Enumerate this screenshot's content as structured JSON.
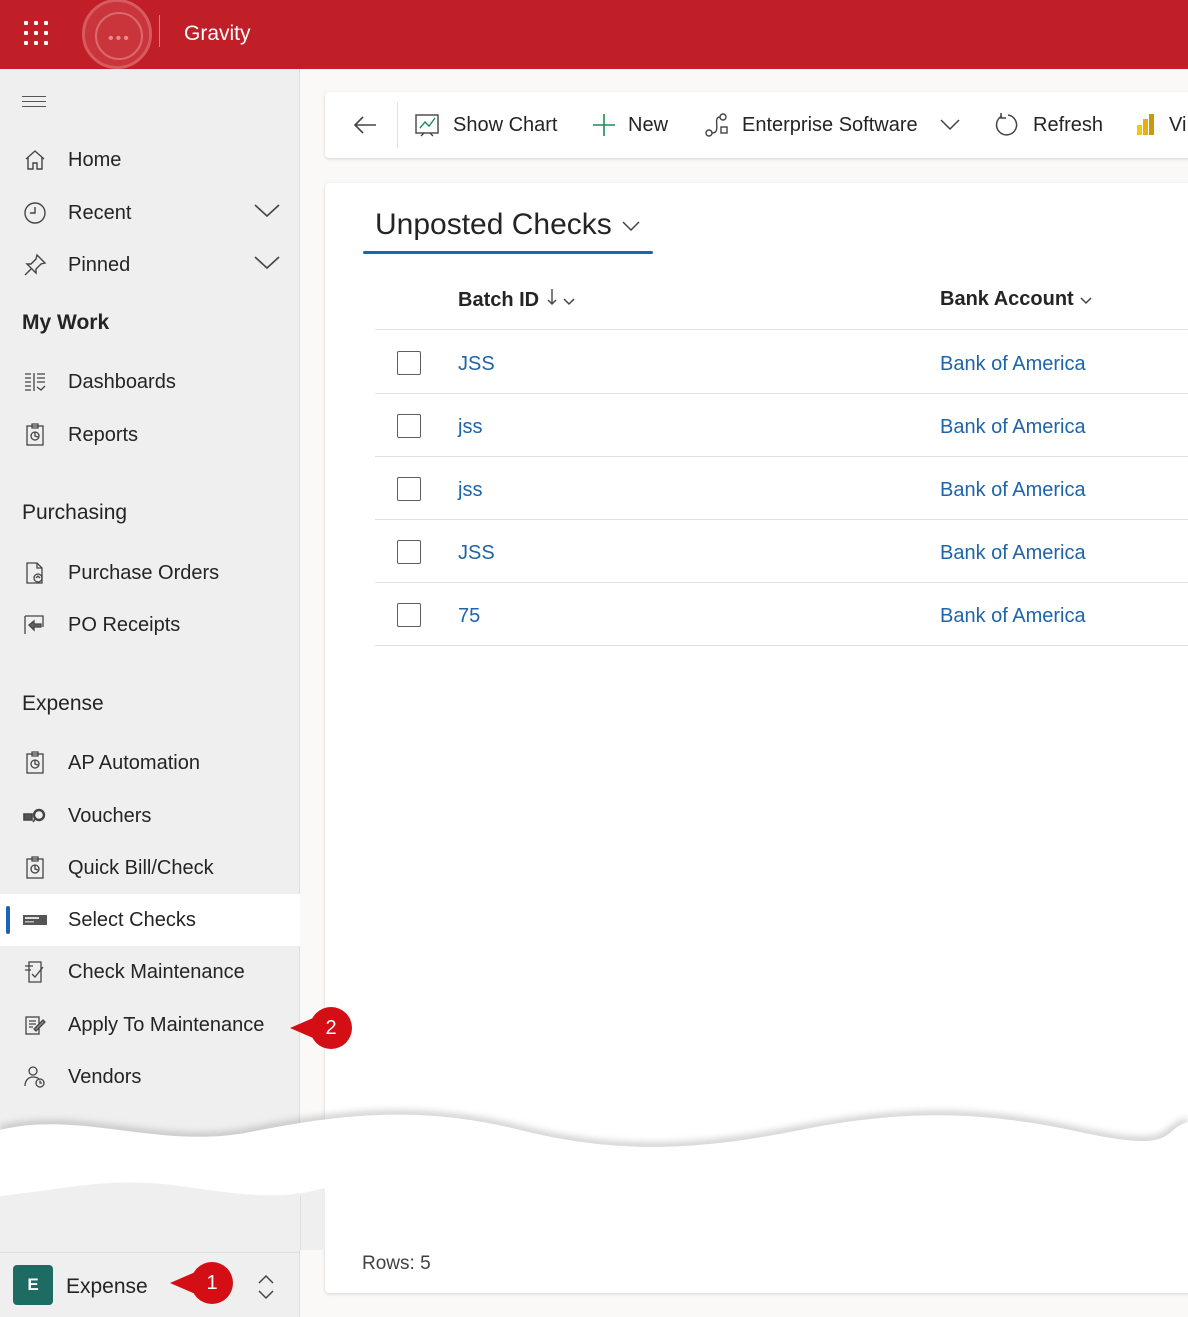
{
  "app": {
    "name": "Gravity"
  },
  "sidebar": {
    "top_items": [
      {
        "label": "Home",
        "icon": "home-icon"
      },
      {
        "label": "Recent",
        "icon": "clock-icon"
      },
      {
        "label": "Pinned",
        "icon": "pin-icon"
      }
    ],
    "groups": [
      {
        "title": "My Work",
        "items": [
          {
            "label": "Dashboards",
            "icon": "dashboard-icon"
          },
          {
            "label": "Reports",
            "icon": "report-icon"
          }
        ]
      },
      {
        "title": "Purchasing",
        "items": [
          {
            "label": "Purchase Orders",
            "icon": "purchase-order-icon"
          },
          {
            "label": "PO Receipts",
            "icon": "receipt-icon"
          }
        ]
      },
      {
        "title": "Expense",
        "items": [
          {
            "label": "AP Automation",
            "icon": "report-icon"
          },
          {
            "label": "Vouchers",
            "icon": "voucher-icon"
          },
          {
            "label": "Quick Bill/Check",
            "icon": "report-icon"
          },
          {
            "label": "Select Checks",
            "icon": "check-card-icon",
            "selected": true
          },
          {
            "label": "Check Maintenance",
            "icon": "check-maintenance-icon"
          },
          {
            "label": "Apply To Maintenance",
            "icon": "apply-maintenance-icon"
          },
          {
            "label": "Vendors",
            "icon": "vendors-icon"
          }
        ]
      }
    ],
    "area": {
      "badge": "E",
      "name": "Expense"
    }
  },
  "callouts": {
    "one": "1",
    "two": "2"
  },
  "commands": {
    "show_chart": "Show Chart",
    "new": "New",
    "enterprise": "Enterprise Software",
    "refresh": "Refresh",
    "truncated": "Vi"
  },
  "view": {
    "title": "Unposted Checks"
  },
  "table": {
    "columns": {
      "batch_id": "Batch ID",
      "bank_account": "Bank Account"
    },
    "rows": [
      {
        "batch": "JSS",
        "bank": "Bank of America"
      },
      {
        "batch": "jss",
        "bank": "Bank of America"
      },
      {
        "batch": "jss",
        "bank": "Bank of America"
      },
      {
        "batch": "JSS",
        "bank": "Bank of America"
      },
      {
        "batch": "75",
        "bank": "Bank of America"
      }
    ],
    "rows_label": "Rows: 5"
  },
  "colors": {
    "brand": "#c01f27",
    "link": "#1e64aa",
    "accent": "#1d64b8",
    "callout": "#d30e14",
    "area_badge": "#1e6b63"
  }
}
